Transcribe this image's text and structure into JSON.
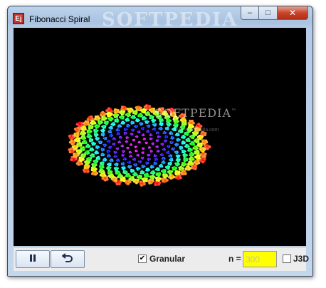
{
  "window": {
    "title": "Fibonacci Spiral",
    "icon_text": "Ej",
    "watermark": "SOFTPEDIA",
    "buttons": {
      "minimize": "‒",
      "maximize": "□",
      "close": "✕"
    }
  },
  "canvas": {
    "background": "#000000",
    "watermark": "SOFTPEDIA",
    "watermark_tm": "™",
    "watermark_url": "www.softpedia.com"
  },
  "toolbar": {
    "pause_icon": "pause-icon",
    "reset_icon": "undo-icon",
    "granular": {
      "label": "Granular",
      "checked": true,
      "mark": "✔"
    },
    "n_label": "n =",
    "n_value": "300",
    "n_color": "#ffff00",
    "j3d": {
      "label": "J3D",
      "checked": false
    }
  }
}
